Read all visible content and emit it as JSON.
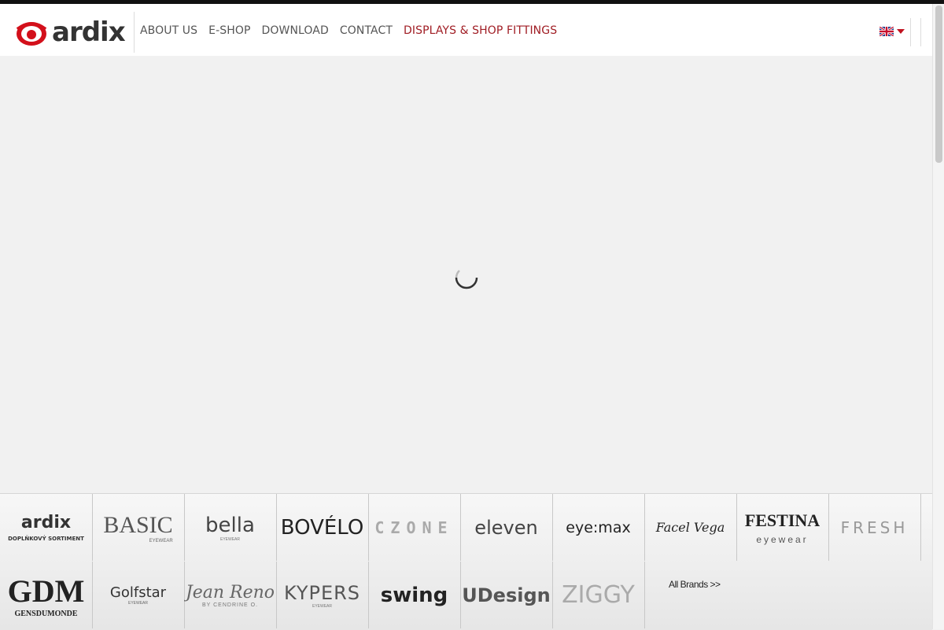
{
  "header": {
    "logo_text": "ardix",
    "nav": [
      {
        "label": "ABOUT US"
      },
      {
        "label": "E-SHOP"
      },
      {
        "label": "DOWNLOAD"
      },
      {
        "label": "CONTACT"
      },
      {
        "label": "DISPLAYS & SHOP FITTINGS",
        "accent": true
      }
    ],
    "language_icon": "uk-flag-icon"
  },
  "brands": {
    "row1": [
      {
        "name": "ardix",
        "sub": "DOPLŇKOVÝ SORTIMENT"
      },
      {
        "name": "BASIC",
        "sub": "EYEWEAR"
      },
      {
        "name": "bella",
        "sub": "EYEWEAR"
      },
      {
        "name": "BOVÉLO"
      },
      {
        "name": "CZONE"
      },
      {
        "name": "eleven"
      },
      {
        "name": "eye:max"
      },
      {
        "name": "Facel Vega"
      },
      {
        "name": "FESTINA",
        "sub": "eyewear"
      },
      {
        "name": "FRESH"
      }
    ],
    "row2": [
      {
        "name": "GDM",
        "sub": "GENSDUMONDE"
      },
      {
        "name": "Golfstar",
        "sub": "EYEWEAR"
      },
      {
        "name": "Jean Reno",
        "sub": "BY CENDRINE O."
      },
      {
        "name": "KYPERS",
        "sub": "EYEWEAR"
      },
      {
        "name": "swing"
      },
      {
        "name": "UDesign"
      },
      {
        "name": "ZIGGY"
      }
    ],
    "all_brands_label": "All Brands >>"
  },
  "colors": {
    "accent": "#a01d24",
    "logo_red": "#d3101b",
    "text": "#555555"
  }
}
